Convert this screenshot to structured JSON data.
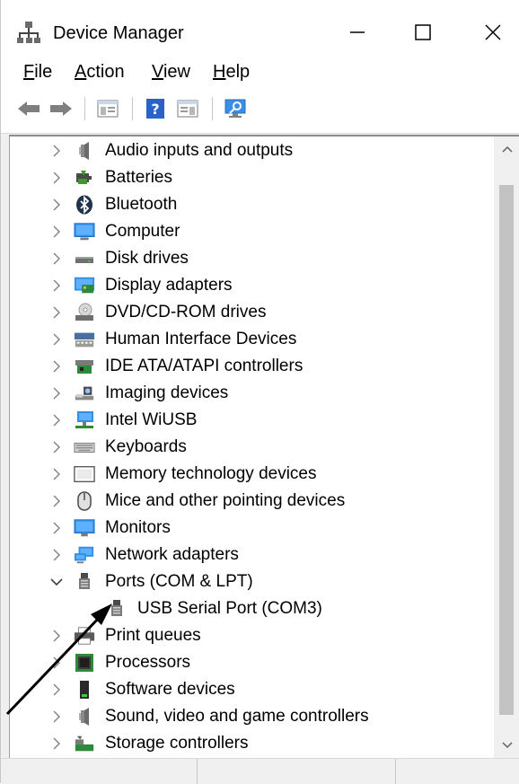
{
  "window": {
    "title": "Device Manager",
    "minimize_label": "—",
    "maximize_label": "☐",
    "close_label": "✕"
  },
  "menubar": {
    "items": [
      {
        "accel": "F",
        "rest": "ile"
      },
      {
        "accel": "A",
        "rest": "ction"
      },
      {
        "accel": "V",
        "rest": "iew"
      },
      {
        "accel": "H",
        "rest": "elp"
      }
    ]
  },
  "toolbar": {
    "icons": [
      "back-arrow-icon",
      "forward-arrow-icon",
      "properties-icon",
      "help-icon",
      "properties-panel-icon",
      "scan-hardware-icon"
    ]
  },
  "tree": {
    "items": [
      {
        "label": "Audio inputs and outputs",
        "icon": "speaker-icon",
        "expanded": false
      },
      {
        "label": "Batteries",
        "icon": "battery-icon",
        "expanded": false
      },
      {
        "label": "Bluetooth",
        "icon": "bluetooth-icon",
        "expanded": false
      },
      {
        "label": "Computer",
        "icon": "computer-icon",
        "expanded": false
      },
      {
        "label": "Disk drives",
        "icon": "disk-drive-icon",
        "expanded": false
      },
      {
        "label": "Display adapters",
        "icon": "display-adapter-icon",
        "expanded": false
      },
      {
        "label": "DVD/CD-ROM drives",
        "icon": "dvd-drive-icon",
        "expanded": false
      },
      {
        "label": "Human Interface Devices",
        "icon": "hid-icon",
        "expanded": false
      },
      {
        "label": "IDE ATA/ATAPI controllers",
        "icon": "ide-controller-icon",
        "expanded": false
      },
      {
        "label": "Imaging devices",
        "icon": "camera-icon",
        "expanded": false
      },
      {
        "label": "Intel WiUSB",
        "icon": "network-monitor-icon",
        "expanded": false
      },
      {
        "label": "Keyboards",
        "icon": "keyboard-icon",
        "expanded": false
      },
      {
        "label": "Memory technology devices",
        "icon": "memory-device-icon",
        "expanded": false
      },
      {
        "label": "Mice and other pointing devices",
        "icon": "mouse-icon",
        "expanded": false
      },
      {
        "label": "Monitors",
        "icon": "monitor-icon",
        "expanded": false
      },
      {
        "label": "Network adapters",
        "icon": "network-adapter-icon",
        "expanded": false
      },
      {
        "label": "Ports (COM & LPT)",
        "icon": "port-icon",
        "expanded": true
      },
      {
        "label": "USB Serial Port (COM3)",
        "icon": "port-icon",
        "child": true
      },
      {
        "label": "Print queues",
        "icon": "printer-icon",
        "expanded": false
      },
      {
        "label": "Processors",
        "icon": "processor-icon",
        "expanded": false
      },
      {
        "label": "Software devices",
        "icon": "software-device-icon",
        "expanded": false
      },
      {
        "label": "Sound, video and game controllers",
        "icon": "speaker-icon",
        "expanded": false
      },
      {
        "label": "Storage controllers",
        "icon": "storage-controller-icon",
        "expanded": false
      }
    ]
  },
  "colors": {
    "accent_blue": "#1e7fd6",
    "window_bg": "#f0f0f0",
    "arrow_annotation": "#000000"
  }
}
